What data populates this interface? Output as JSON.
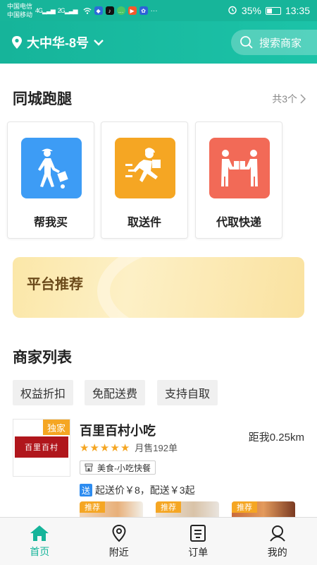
{
  "status_bar": {
    "carrier1": "中国电信",
    "carrier2": "中国移动",
    "net1": "4G",
    "net2": "2G",
    "battery_pct": "35%",
    "time": "13:35"
  },
  "header": {
    "location": "大中华-8号",
    "search_placeholder": "搜索商家"
  },
  "errand": {
    "title": "同城跑腿",
    "more": "共3个",
    "services": [
      {
        "label": "帮我买",
        "color": "#3d9cf5",
        "icon": "cart-person-icon"
      },
      {
        "label": "取送件",
        "color": "#f5a623",
        "icon": "runner-icon"
      },
      {
        "label": "代取快递",
        "color": "#f26a57",
        "icon": "package-handover-icon"
      }
    ]
  },
  "banner": {
    "title": "平台推荐"
  },
  "merchants": {
    "title": "商家列表",
    "filters": [
      "权益折扣",
      "免配送费",
      "支持自取"
    ],
    "items": [
      {
        "badge": "独家",
        "name": "百里百村小吃",
        "logo_text": "百里百村",
        "distance": "距我0.25km",
        "rating": 5,
        "sold": "月售192单",
        "category": "美食-小吃快餐",
        "delivery_tag": "送",
        "delivery": "起送价￥8，配送￥3起",
        "promo_tag": "推荐"
      }
    ]
  },
  "tabbar": {
    "tabs": [
      {
        "label": "首页",
        "icon": "home-icon",
        "active": true
      },
      {
        "label": "附近",
        "icon": "location-pin-icon",
        "active": false
      },
      {
        "label": "订单",
        "icon": "order-list-icon",
        "active": false
      },
      {
        "label": "我的",
        "icon": "user-icon",
        "active": false
      }
    ]
  },
  "colors": {
    "primary": "#16b49a",
    "star": "#f5a623"
  }
}
